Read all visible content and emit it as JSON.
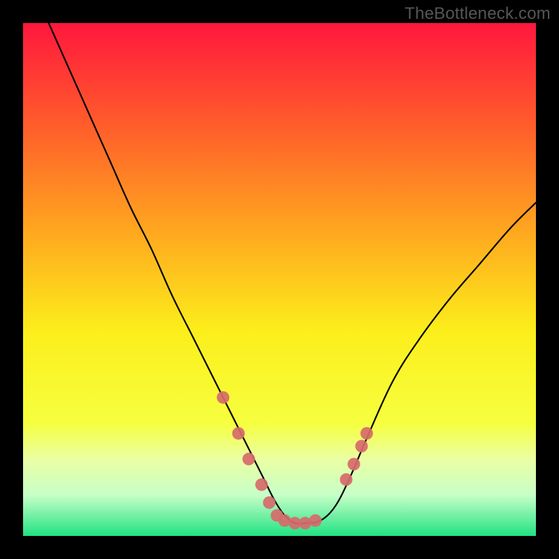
{
  "watermark": "TheBottleneck.com",
  "chart_data": {
    "type": "line",
    "title": "",
    "xlabel": "",
    "ylabel": "",
    "xlim": [
      0,
      100
    ],
    "ylim": [
      0,
      100
    ],
    "grid": false,
    "legend": false,
    "gradient_stops": [
      {
        "offset": 0.0,
        "color": "#ff173d"
      },
      {
        "offset": 0.2,
        "color": "#ff5d2b"
      },
      {
        "offset": 0.4,
        "color": "#ffa51f"
      },
      {
        "offset": 0.6,
        "color": "#fcee1b"
      },
      {
        "offset": 0.78,
        "color": "#f6ff3f"
      },
      {
        "offset": 0.85,
        "color": "#eaffa3"
      },
      {
        "offset": 0.92,
        "color": "#c7ffc7"
      },
      {
        "offset": 1.0,
        "color": "#21e283"
      }
    ],
    "series": [
      {
        "name": "bottleneck-curve",
        "color": "#000000",
        "x": [
          5,
          9,
          13,
          17,
          21,
          25,
          29,
          33,
          36,
          39,
          42,
          45,
          47,
          49,
          51,
          53,
          55,
          58,
          61,
          64,
          67,
          72,
          77,
          83,
          89,
          95,
          100
        ],
        "y": [
          100,
          91,
          82,
          73,
          64,
          56,
          47,
          39,
          33,
          27,
          21,
          15,
          11,
          7,
          4,
          2.5,
          2.5,
          3,
          6,
          12,
          19,
          30,
          38,
          46,
          53,
          60,
          65
        ]
      }
    ],
    "markers": {
      "name": "highlight-dots",
      "color": "#d66a6a",
      "radius_px": 9,
      "points": [
        {
          "x": 39.0,
          "y": 27.0
        },
        {
          "x": 42.0,
          "y": 20.0
        },
        {
          "x": 44.0,
          "y": 15.0
        },
        {
          "x": 46.5,
          "y": 10.0
        },
        {
          "x": 48.0,
          "y": 6.5
        },
        {
          "x": 49.5,
          "y": 4.0
        },
        {
          "x": 51.0,
          "y": 3.0
        },
        {
          "x": 53.0,
          "y": 2.5
        },
        {
          "x": 55.0,
          "y": 2.5
        },
        {
          "x": 57.0,
          "y": 3.0
        },
        {
          "x": 63.0,
          "y": 11.0
        },
        {
          "x": 64.5,
          "y": 14.0
        },
        {
          "x": 66.0,
          "y": 17.5
        },
        {
          "x": 67.0,
          "y": 20.0
        }
      ]
    }
  }
}
